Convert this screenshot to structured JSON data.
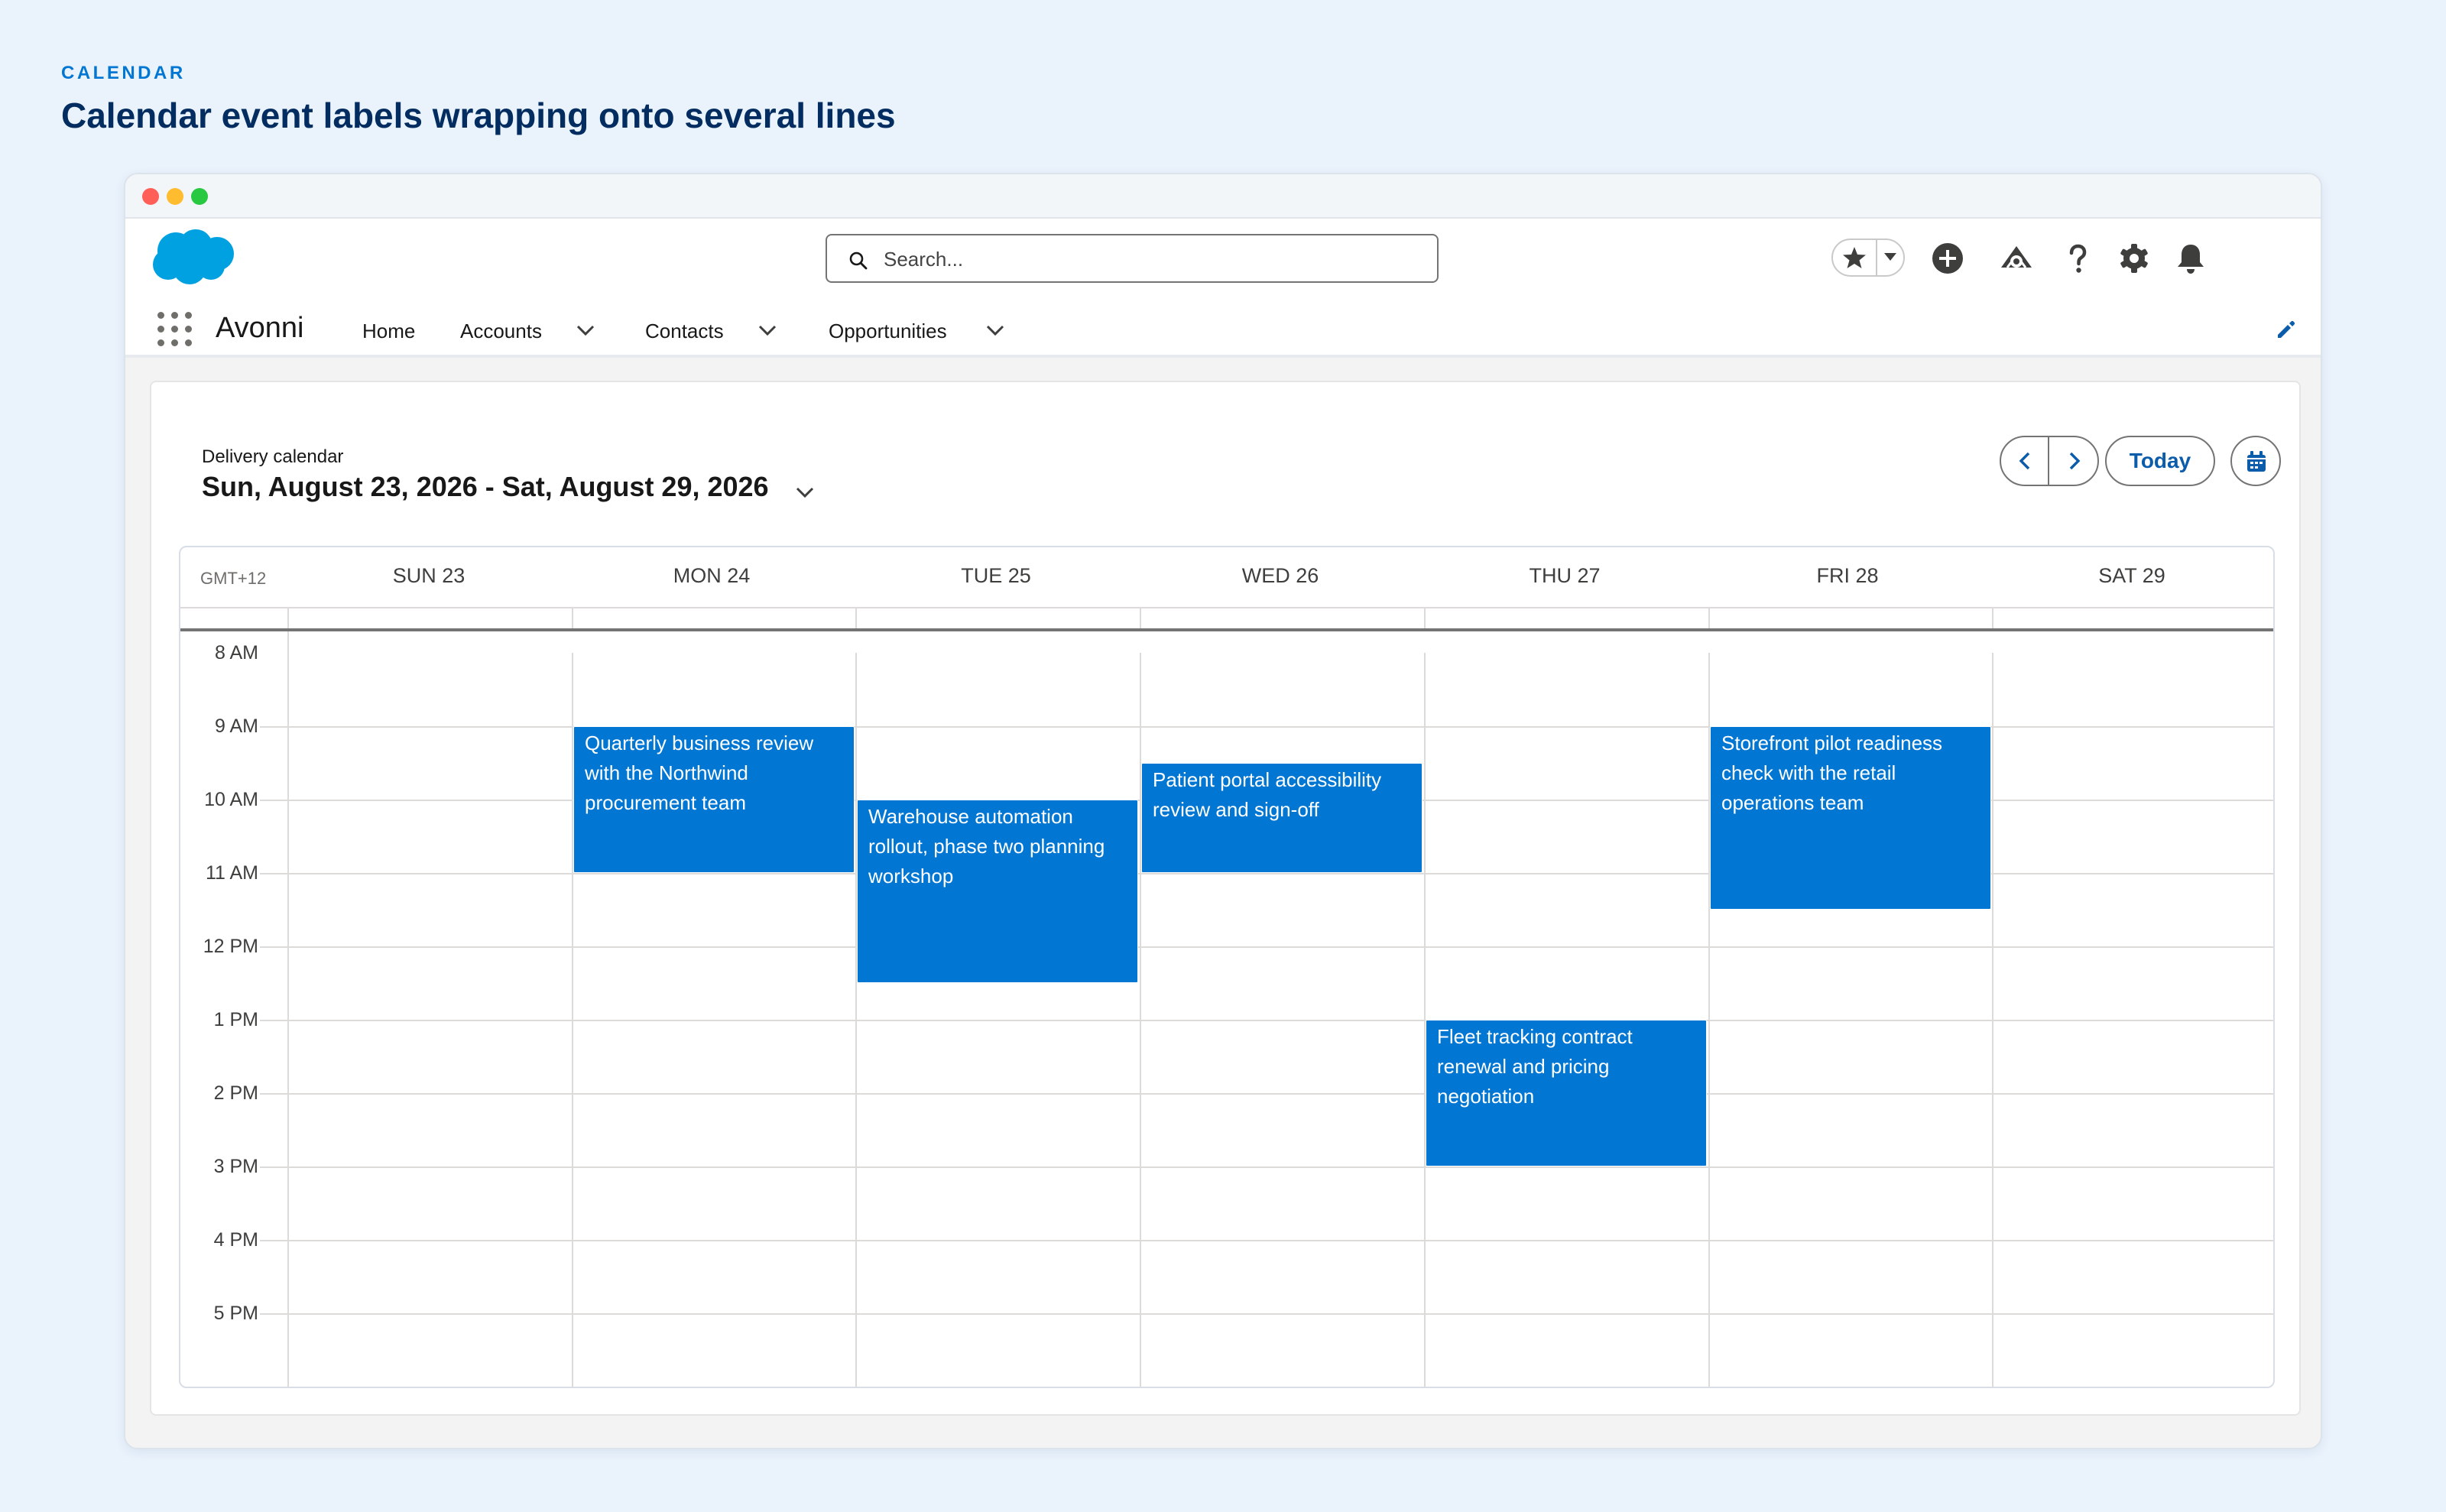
{
  "page": {
    "eyebrow": "CALENDAR",
    "heading": "Calendar event labels wrapping onto several lines"
  },
  "header": {
    "search_placeholder": "Search..."
  },
  "nav": {
    "app_name": "Avonni",
    "items": [
      "Home",
      "Accounts",
      "Contacts",
      "Opportunities"
    ]
  },
  "calendar": {
    "label": "Delivery calendar",
    "range": "Sun, August 23, 2026 - Sat, August 29, 2026",
    "today_label": "Today",
    "timezone": "GMT+12",
    "days": [
      "SUN 23",
      "MON 24",
      "TUE 25",
      "WED 26",
      "THU 27",
      "FRI 28",
      "SAT 29"
    ],
    "hours": [
      "8 AM",
      "9 AM",
      "10 AM",
      "11 AM",
      "12 PM",
      "1 PM",
      "2 PM",
      "3 PM",
      "4 PM",
      "5 PM"
    ],
    "events": [
      {
        "title": "Quarterly business review with the Northwind procurement team",
        "day": 1,
        "start": 9,
        "end": 11
      },
      {
        "title": "Warehouse automation rollout, phase two planning workshop",
        "day": 2,
        "start": 10,
        "end": 12.5
      },
      {
        "title": "Patient portal accessibility review and sign-off",
        "day": 3,
        "start": 9.5,
        "end": 11
      },
      {
        "title": "Fleet tracking contract renewal and pricing negotiation",
        "day": 4,
        "start": 13,
        "end": 15
      },
      {
        "title": "Storefront pilot readiness check with the retail operations team",
        "day": 5,
        "start": 9,
        "end": 11.5
      }
    ]
  },
  "colors": {
    "brand": "#0176d3",
    "event_bg": "#0176d3",
    "link": "#0b5cab"
  }
}
